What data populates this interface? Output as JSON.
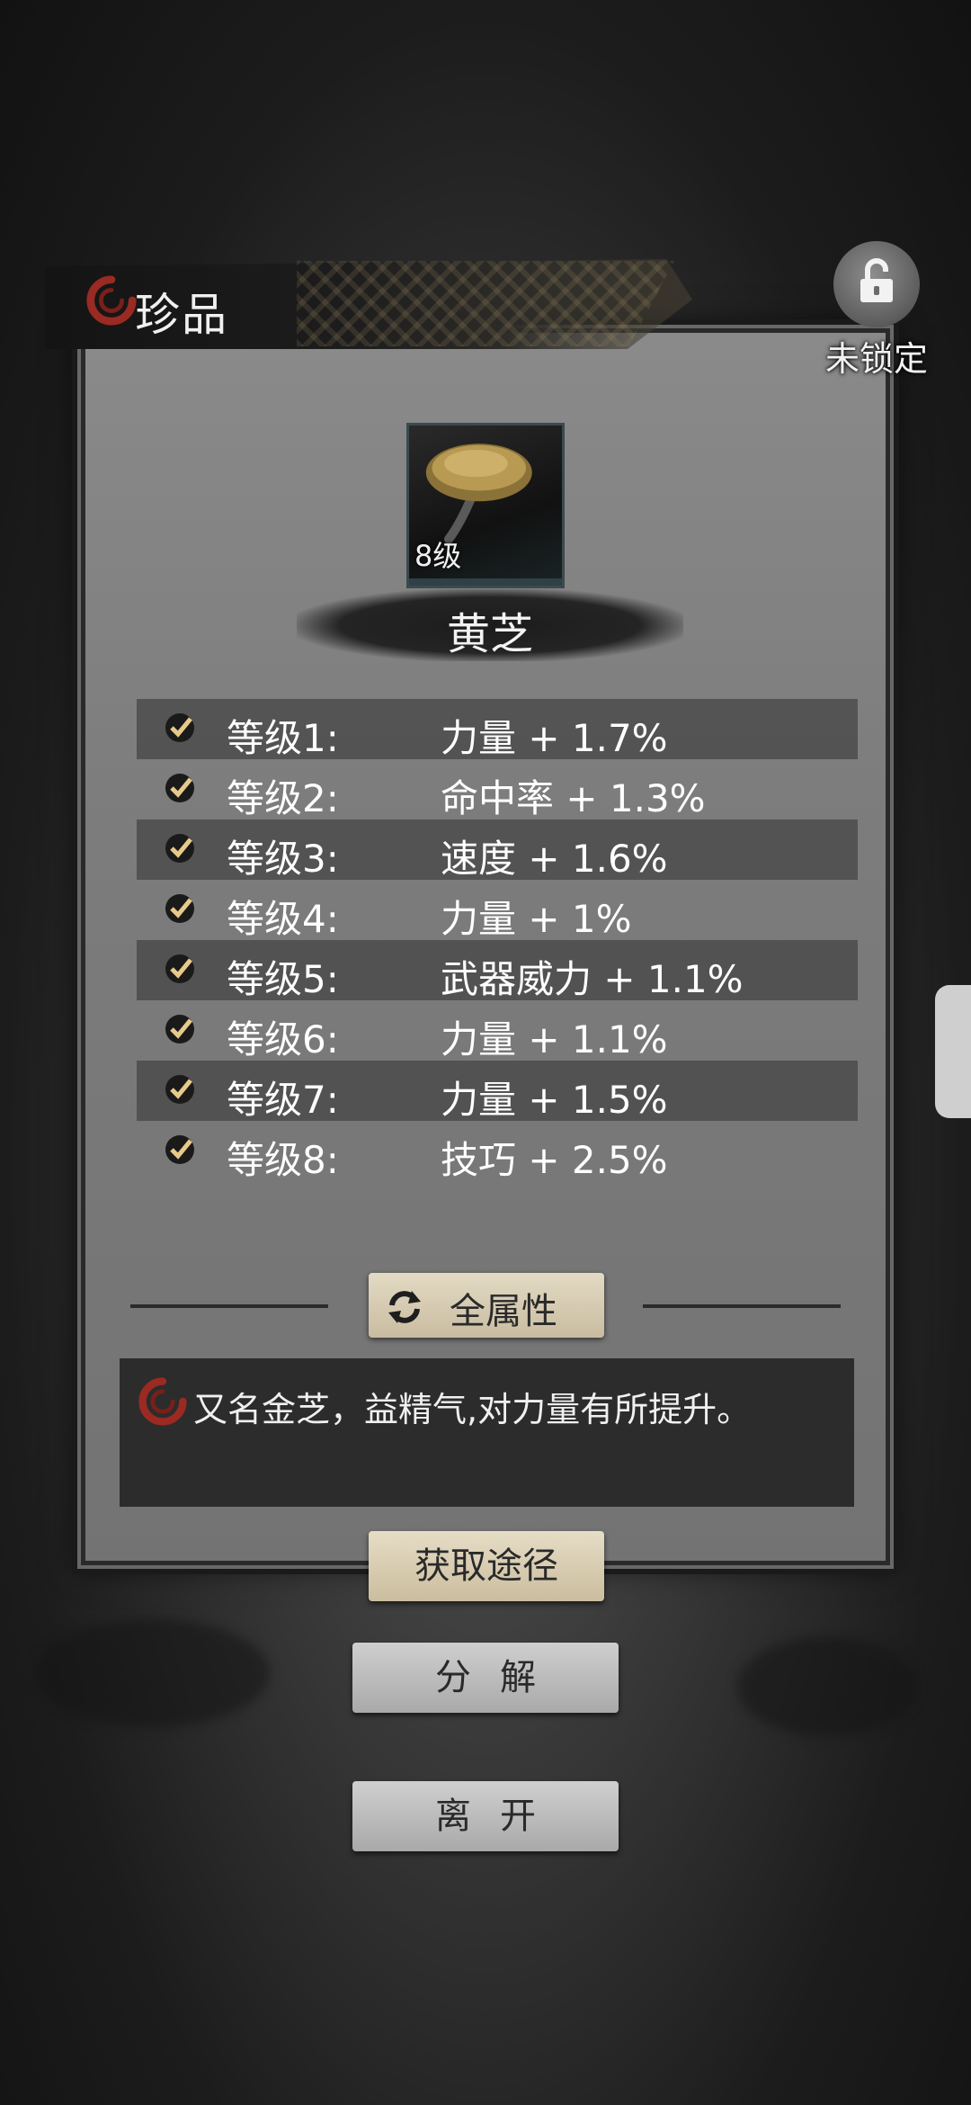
{
  "header": {
    "title": "珍品",
    "lock_label": "未锁定"
  },
  "item": {
    "level_badge": "8级",
    "name": "黄芝"
  },
  "stats": [
    {
      "level": "等级1:",
      "value": "力量 + 1.7%"
    },
    {
      "level": "等级2:",
      "value": "命中率 + 1.3%"
    },
    {
      "level": "等级3:",
      "value": "速度 + 1.6%"
    },
    {
      "level": "等级4:",
      "value": "力量 + 1%"
    },
    {
      "level": "等级5:",
      "value": "武器威力 + 1.1%"
    },
    {
      "level": "等级6:",
      "value": "力量 + 1.1%"
    },
    {
      "level": "等级7:",
      "value": "力量 + 1.5%"
    },
    {
      "level": "等级8:",
      "value": "技巧 + 2.5%"
    }
  ],
  "all_attributes_label": "全属性",
  "description": "又名金芝，益精气,对力量有所提升。",
  "buttons": {
    "obtain_label": "获取途径",
    "decompose_label": "分解",
    "leave_label": "离开"
  },
  "colors": {
    "accent_swirl": "#9a2a22",
    "button_gold": "#d9ceb4",
    "button_grey": "#bdbdbd"
  }
}
